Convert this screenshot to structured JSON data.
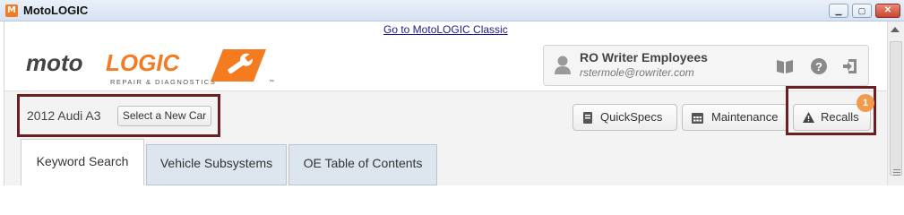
{
  "window": {
    "title": "MotoLOGIC",
    "app_icon": "M",
    "controls": {
      "minimize": "▁",
      "maximize": "▢",
      "close": "✕"
    }
  },
  "header": {
    "classic_link": "Go to MotoLOGIC Classic",
    "logo": {
      "wordmark_part1": "moto",
      "wordmark_part2": "LOGIC",
      "tagline": "REPAIR & DIAGNOSTICS",
      "trademark": "™",
      "brand_color": "#f47b20"
    }
  },
  "user": {
    "name": "RO Writer Employees",
    "email": "rstermole@rowriter.com",
    "icons": [
      "user-icon",
      "book-icon",
      "help-icon",
      "logout-icon"
    ]
  },
  "vehicle": {
    "name": "2012 Audi A3",
    "select_label": "Select a New Car"
  },
  "actions": {
    "quickspecs": "QuickSpecs",
    "maintenance": "Maintenance",
    "recalls": "Recalls",
    "recalls_badge": "1"
  },
  "tabs": [
    "Keyword Search",
    "Vehicle Subsystems",
    "OE Table of Contents"
  ],
  "colors": {
    "accent": "#f47b20",
    "highlight_border": "#6b1f22",
    "badge": "#f39a4c",
    "tab_inactive": "#dde6ee"
  }
}
